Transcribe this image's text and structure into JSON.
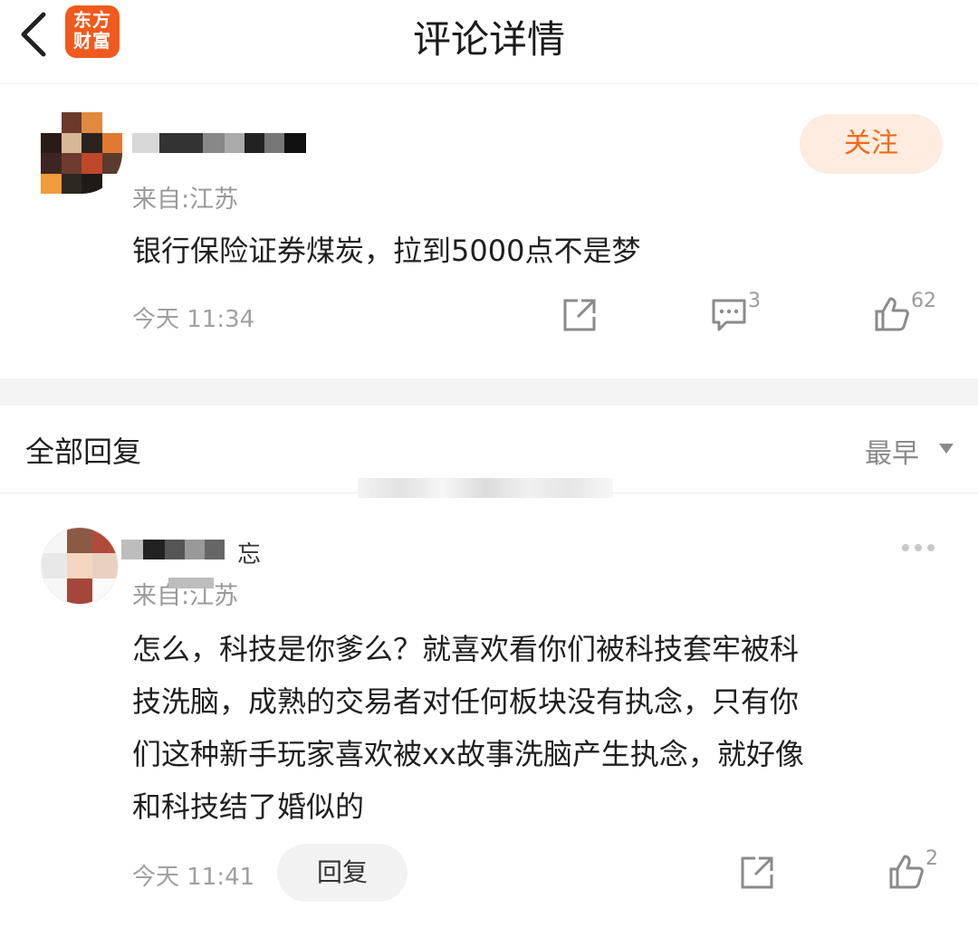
{
  "header": {
    "title": "评论详情",
    "logo_line1": "东方",
    "logo_line2": "财富",
    "logo_color": "#f05a1e"
  },
  "comment": {
    "location": "来自:江苏",
    "text": "银行保险证券煤炭，拉到5000点不是梦",
    "time": "今天 11:34",
    "follow_label": "关注",
    "reply_count": "3",
    "like_count": "62"
  },
  "replies_section": {
    "title": "全部回复",
    "sort_label": "最早"
  },
  "reply": {
    "name_suffix": "忘",
    "location": "来自:江苏",
    "text_lines": [
      "怎么，科技是你爹么？就喜欢看你们被科技套牢被科",
      "技洗脑，成熟的交易者对任何板块没有执念，只有你",
      "们这种新手玩家喜欢被xx故事洗脑产生执念，就好像",
      "和科技结了婚似的"
    ],
    "time": "今天 11:41",
    "reply_label": "回复",
    "like_count": "2"
  },
  "icons": {
    "back": "back-chevron-icon",
    "share": "share-icon",
    "comment": "comment-icon",
    "like": "thumbs-up-icon",
    "more": "more-dots-icon",
    "sort": "caret-down-icon"
  }
}
